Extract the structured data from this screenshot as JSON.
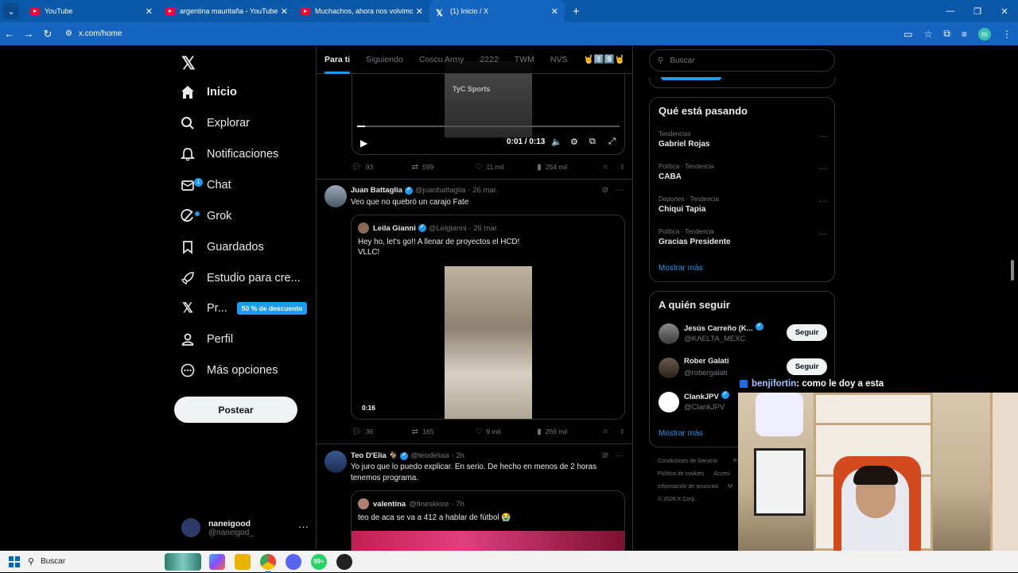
{
  "browser": {
    "tabs": [
      {
        "title": "YouTube",
        "icon": "youtube-icon"
      },
      {
        "title": "argentina mauritaña - YouTube",
        "icon": "youtube-icon"
      },
      {
        "title": "Muchachos, ahora nos volvimo",
        "icon": "youtube-icon"
      },
      {
        "title": "(1) Inicio / X",
        "icon": "x-icon",
        "active": true
      }
    ],
    "url": "x.com/home",
    "profile_initial": "m"
  },
  "nav": {
    "items": [
      {
        "label": "Inicio",
        "icon": "home-icon",
        "active": true
      },
      {
        "label": "Explorar",
        "icon": "search-icon"
      },
      {
        "label": "Notificaciones",
        "icon": "bell-icon"
      },
      {
        "label": "Chat",
        "icon": "mail-icon",
        "badge": "1"
      },
      {
        "label": "Grok",
        "icon": "grok-icon",
        "dot": true
      },
      {
        "label": "Guardados",
        "icon": "bookmark-icon"
      },
      {
        "label": "Estudio para cre...",
        "icon": "rocket-icon"
      },
      {
        "label": "Pr...",
        "icon": "x-premium-icon",
        "promo": "50 % de descuento"
      },
      {
        "label": "Perfil",
        "icon": "user-icon"
      },
      {
        "label": "Más opciones",
        "icon": "more-circle-icon"
      }
    ],
    "post_button": "Postear",
    "account": {
      "name": "naneigood",
      "handle": "@naneigod_"
    }
  },
  "main": {
    "tabs": [
      "Para ti",
      "Siguiendo",
      "Coscu Army",
      "2222",
      "TWM",
      "NVS",
      "🤘1️⃣9️⃣🤘"
    ],
    "video1": {
      "watermark": "TyC Sports",
      "time": "0:01 / 0:13",
      "progress": 0.03
    },
    "actions1": {
      "replies": "93",
      "reposts": "599",
      "likes": "11 mil",
      "views": "254 mil"
    },
    "tweet2": {
      "name": "Juan Battaglia",
      "handle": "@juanbattaglia",
      "date": "· 26 mar.",
      "text": "Veo que no quebró un carajo Fate",
      "quote": {
        "name": "Leila Gianni",
        "handle": "@Lelgianni",
        "date": "· 26 mar.",
        "text1": "Hey ho, let's go!! A llenar de proyectos el HCD!",
        "text2": "VLLC!",
        "duration": "0:16"
      },
      "actions": {
        "replies": "36",
        "reposts": "165",
        "likes": "9 mil",
        "views": "269 mil"
      }
    },
    "tweet3": {
      "name": "Teo D'Elia 🐐",
      "handle": "@teodeliaa",
      "date": "· 2h",
      "text1": "Yo juro que lo puedo explicar. En serio. De hecho en menos de 2 horas",
      "text2": "tenemos programa.",
      "quote": {
        "name": "valentina",
        "handle": "@fineskiore",
        "date": "· 7h",
        "text": "teo de aca se va a 412 a hablar de fútbol 😭"
      }
    }
  },
  "right": {
    "search_placeholder": "Buscar",
    "trends_title": "Qué está pasando",
    "trends": [
      {
        "category": "Tendencias",
        "title": "Gabriel Rojas"
      },
      {
        "category": "Política · Tendencia",
        "title": "CABA"
      },
      {
        "category": "Deportes · Tendencia",
        "title": "Chiqui Tapia"
      },
      {
        "category": "Política · Tendencia",
        "title": "Gracias Presidente"
      }
    ],
    "show_more": "Mostrar más",
    "follow_title": "A quién seguir",
    "follow": [
      {
        "name": "Jesús Carreño (K...",
        "handle": "@KAELTA_MEXC",
        "verified": true,
        "button": "Seguir"
      },
      {
        "name": "Rober Galati",
        "handle": "@robergalati",
        "verified": false,
        "button": "Seguir"
      },
      {
        "name": "ClankJPV",
        "handle": "@ClankJPV",
        "verified": true
      }
    ],
    "show_more2": "Mostrar más",
    "footer": [
      "Condiciones de Servicio",
      "Política de cookies",
      "Información de anuncios",
      "© 2026 X Corp."
    ],
    "footer_fragments": [
      "P",
      "Accesi",
      "M"
    ]
  },
  "overlay": {
    "user": "benjifortin",
    "message": ": como le doy a esta"
  },
  "taskbar": {
    "search": "Buscar"
  },
  "colors": {
    "accent": "#1d9bf0",
    "browser_chrome": "#1565c0",
    "background": "#000000"
  }
}
